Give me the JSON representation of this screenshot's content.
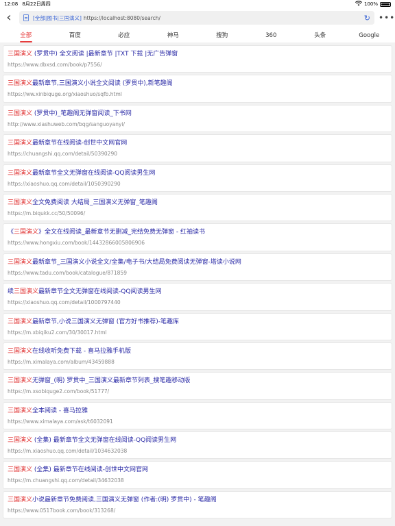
{
  "status": {
    "time": "12:08",
    "date": "8月22日周四",
    "battery": "100%"
  },
  "url_bar": {
    "tag": "[全部|图书|三国演义]",
    "url": "https://localhost:8080/search/"
  },
  "tabs": [
    {
      "label": "全部",
      "active": true
    },
    {
      "label": "百度",
      "active": false
    },
    {
      "label": "必应",
      "active": false
    },
    {
      "label": "神马",
      "active": false
    },
    {
      "label": "搜狗",
      "active": false
    },
    {
      "label": "360",
      "active": false
    },
    {
      "label": "头条",
      "active": false
    },
    {
      "label": "Google",
      "active": false
    }
  ],
  "colors": {
    "accent": "#e63c3c",
    "link": "#2a2aa6",
    "url": "#888888"
  },
  "results": [
    {
      "parts": [
        {
          "t": "三国演义",
          "h": true
        },
        {
          "t": " (罗贯中) 全文阅读 |最新章节 |TXT 下载 |无广告弹窗",
          "h": false
        }
      ],
      "url": "https://www.dbxsd.com/book/p7556/"
    },
    {
      "parts": [
        {
          "t": "三国演义",
          "h": true
        },
        {
          "t": "最新章节,三国演义小说全文阅读 (罗贯中),新笔趣阁",
          "h": false
        }
      ],
      "url": "https://ww.xinbiquge.org/xiaoshuo/sqfb.html"
    },
    {
      "parts": [
        {
          "t": "三国演义",
          "h": true
        },
        {
          "t": " (罗贯中)_笔趣阁无弹窗阅读_下书网",
          "h": false
        }
      ],
      "url": "http://www.xiashuweb.com/bqg/sanguoyanyi/"
    },
    {
      "parts": [
        {
          "t": "三国演义",
          "h": true
        },
        {
          "t": "最新章节在线阅读-创世中文网官网",
          "h": false
        }
      ],
      "url": "https://chuangshi.qq.com/detail/50390290"
    },
    {
      "parts": [
        {
          "t": "三国演义",
          "h": true
        },
        {
          "t": "最新章节全文无弹窗在线阅读-QQ阅读男生网",
          "h": false
        }
      ],
      "url": "https://xiaoshuo.qq.com/detail/1050390290"
    },
    {
      "parts": [
        {
          "t": "三国演义",
          "h": true
        },
        {
          "t": "全文免费阅读 大结局_三国演义无弹窗_笔趣阁",
          "h": false
        }
      ],
      "url": "https://m.biqukk.cc/50/50096/"
    },
    {
      "parts": [
        {
          "t": "《",
          "h": false
        },
        {
          "t": "三国演义",
          "h": true
        },
        {
          "t": "》全文在线阅读_最新章节无删减_完结免费无弹窗 - 红袖读书",
          "h": false
        }
      ],
      "url": "https://www.hongxiu.com/book/14432866005806906"
    },
    {
      "parts": [
        {
          "t": "三国演义",
          "h": true
        },
        {
          "t": "最新章节_三国演义小说全文/全集/电子书/大结局免费阅读无弹窗-塔读小说网",
          "h": false
        }
      ],
      "url": "https://www.tadu.com/book/catalogue/871859"
    },
    {
      "parts": [
        {
          "t": "续",
          "h": false
        },
        {
          "t": "三国演义",
          "h": true
        },
        {
          "t": "最新章节全文无弹窗在线阅读-QQ阅读男生网",
          "h": false
        }
      ],
      "url": "https://xiaoshuo.qq.com/detail/1000797440"
    },
    {
      "parts": [
        {
          "t": "三国演义",
          "h": true
        },
        {
          "t": "最新章节,小说三国演义无弹窗 (官方好书推荐)-笔趣库",
          "h": false
        }
      ],
      "url": "https://m.xbiqiku2.com/30/30017.html"
    },
    {
      "parts": [
        {
          "t": "三国演义",
          "h": true
        },
        {
          "t": "在线收听免费下载 - 喜马拉雅手机版",
          "h": false
        }
      ],
      "url": "https://m.ximalaya.com/album/43459888"
    },
    {
      "parts": [
        {
          "t": "三国演义",
          "h": true
        },
        {
          "t": "无弹窗_(明) 罗贯中_三国演义最新章节列表_搜笔趣移动版",
          "h": false
        }
      ],
      "url": "https://m.xsobiquge2.com/book/51777/"
    },
    {
      "parts": [
        {
          "t": "三国演义",
          "h": true
        },
        {
          "t": "全本阅读 - 喜马拉雅",
          "h": false
        }
      ],
      "url": "https://www.ximalaya.com/ask/t6032091"
    },
    {
      "parts": [
        {
          "t": "三国演义",
          "h": true
        },
        {
          "t": " (全集) 最新章节全文无弹窗在线阅读-QQ阅读男生网",
          "h": false
        }
      ],
      "url": "https://m.xiaoshuo.qq.com/detail/1034632038"
    },
    {
      "parts": [
        {
          "t": "三国演义",
          "h": true
        },
        {
          "t": " (全集) 最新章节在线阅读-创世中文网官网",
          "h": false
        }
      ],
      "url": "https://m.chuangshi.qq.com/detail/34632038"
    },
    {
      "parts": [
        {
          "t": "三国演义",
          "h": true
        },
        {
          "t": "小说最新章节免费阅读,三国演义无弹窗 (作者:(明) 罗贯中) - 笔趣阁",
          "h": false
        }
      ],
      "url": "https://www.0517book.com/book/313268/"
    }
  ]
}
